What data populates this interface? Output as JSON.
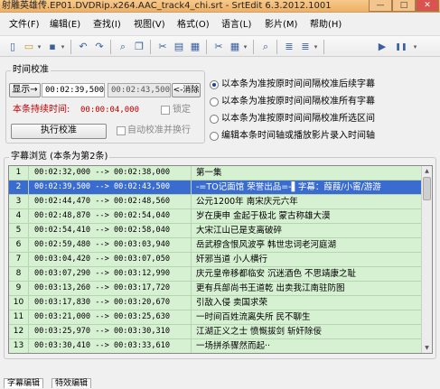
{
  "window": {
    "title": "射雕英雄传.EP01.DVDRip.x264.AAC_track4_chi.srt - SrtEdit 6.3.2012.1001",
    "minimize": "—",
    "maximize": "□",
    "close": "✕"
  },
  "menu": [
    "文件(F)",
    "编辑(E)",
    "查找(I)",
    "视图(V)",
    "格式(O)",
    "语言(L)",
    "影片(M)",
    "帮助(H)"
  ],
  "toolbar": {
    "icons": [
      "new-doc-icon",
      "open-folder-icon",
      "save-icon",
      "undo-icon",
      "redo-icon",
      "find-icon",
      "copy-icon",
      "cut-icon",
      "paste-icon",
      "clipboard-icon",
      "indent-icon",
      "play-icon",
      "pause-icon"
    ],
    "glyphs": {
      "new": "▯",
      "open": "▭",
      "save": "▪",
      "undo": "↶",
      "redo": "↷",
      "find": "⌕",
      "copy": "❐",
      "cut": "✂",
      "paste": "▤",
      "clip": "▦",
      "indent": "≣",
      "play": "▶",
      "pause": "❚❚",
      "dropdown": "▾"
    }
  },
  "timing": {
    "group_title": "时间校准",
    "display_button": "显示→",
    "start_time": "00:02:39,500",
    "end_time": "00:02:43,500",
    "clear_button": "<-消除",
    "duration_label": "本条持续时间:",
    "duration_value": "00:00:04,000",
    "lock_label": "锁定",
    "execute_button": "执行校准",
    "auto_label": "自动校准并换行",
    "options": [
      {
        "label": "以本条为准按原时间间隔校准后续字幕",
        "selected": true
      },
      {
        "label": "以本条为准按原时间间隔校准所有字幕",
        "selected": false
      },
      {
        "label": "以本条为准按原时间间隔校准所选区间",
        "selected": false
      },
      {
        "label": "编辑本条时间轴或播放影片录入时间轴",
        "selected": false
      }
    ]
  },
  "browse": {
    "group_title": "字幕浏览 (本条为第2条)",
    "rows": [
      {
        "n": "1",
        "time": "00:02:32,000 --> 00:02:38,000",
        "text": "第一集",
        "selected": false
      },
      {
        "n": "2",
        "time": "00:02:39,500 --> 00:02:43,500",
        "text": "-=TO记面馆 荣誉出品=-▌字幕：葭葭/小甯/游游",
        "selected": true
      },
      {
        "n": "3",
        "time": "00:02:44,470 --> 00:02:48,560",
        "text": "公元1200年 南宋庆元六年",
        "selected": false
      },
      {
        "n": "4",
        "time": "00:02:48,870 --> 00:02:54,040",
        "text": "岁在庚申 金起于极北 蒙古称雄大漠",
        "selected": false
      },
      {
        "n": "5",
        "time": "00:02:54,410 --> 00:02:58,040",
        "text": "大宋江山已是支离破碎",
        "selected": false
      },
      {
        "n": "6",
        "time": "00:02:59,480 --> 00:03:03,940",
        "text": "岳武穆含恨风波亭 韩世忠词老河庭湖",
        "selected": false
      },
      {
        "n": "7",
        "time": "00:03:04,420 --> 00:03:07,050",
        "text": "奸邪当道 小人横行",
        "selected": false
      },
      {
        "n": "8",
        "time": "00:03:07,290 --> 00:03:12,990",
        "text": "庆元皇帝移都临安 沉迷酒色 不思靖康之耻",
        "selected": false
      },
      {
        "n": "9",
        "time": "00:03:13,260 --> 00:03:17,720",
        "text": "更有兵部尚书王道乾 出卖我江南驻防图",
        "selected": false
      },
      {
        "n": "10",
        "time": "00:03:17,830 --> 00:03:20,670",
        "text": "引敌入侵 卖国求荣",
        "selected": false
      },
      {
        "n": "11",
        "time": "00:03:21,000 --> 00:03:25,630",
        "text": "一时间百姓流离失所 民不聊生",
        "selected": false
      },
      {
        "n": "12",
        "time": "00:03:25,970 --> 00:03:30,310",
        "text": "江湖正义之士 愤慨拔剑 斩奸除佞",
        "selected": false
      },
      {
        "n": "13",
        "time": "00:03:30,410 --> 00:03:33,610",
        "text": "一场拼杀骤然而起··",
        "selected": false
      }
    ],
    "scroll_up": "▲",
    "scroll_down": "▼"
  },
  "tabs": [
    "字幕编辑",
    "特效编辑"
  ]
}
